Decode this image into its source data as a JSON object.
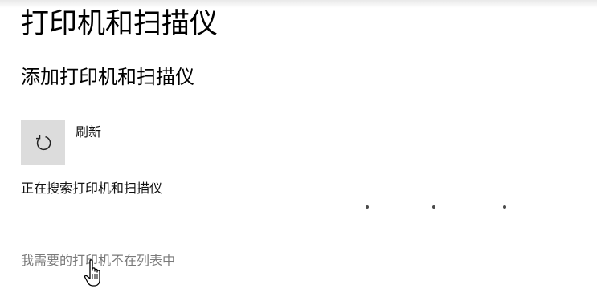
{
  "page": {
    "title": "打印机和扫描仪"
  },
  "add_section": {
    "heading": "添加打印机和扫描仪",
    "refresh_icon": "refresh-icon",
    "refresh_label": "刷新",
    "status": "正在搜索打印机和扫描仪",
    "progress_dots": 3,
    "missing_link": "我需要的打印机不在列表中"
  },
  "cursor": {
    "icon": "hand-pointer-cursor-icon"
  },
  "colors": {
    "button_bg": "#dcdcdc",
    "link": "#7a7a7a",
    "dot": "#4a4a4a"
  }
}
